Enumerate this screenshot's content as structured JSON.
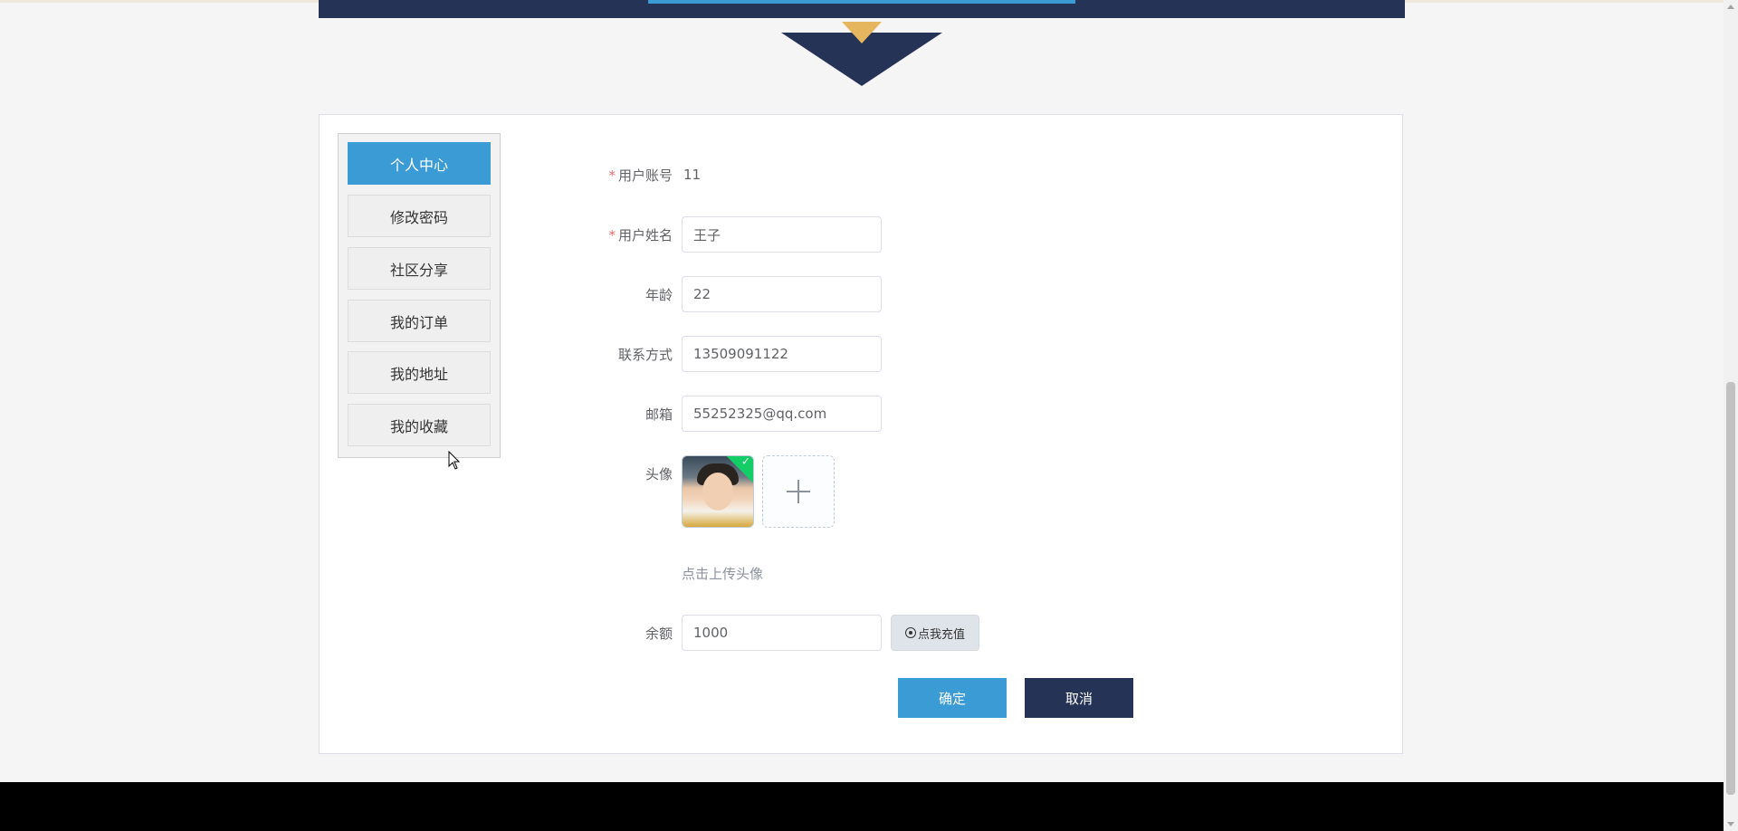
{
  "menu": {
    "items": [
      {
        "label": "个人中心",
        "active": true
      },
      {
        "label": "修改密码",
        "active": false
      },
      {
        "label": "社区分享",
        "active": false
      },
      {
        "label": "我的订单",
        "active": false
      },
      {
        "label": "我的地址",
        "active": false
      },
      {
        "label": "我的收藏",
        "active": false
      }
    ]
  },
  "form": {
    "account": {
      "label": "用户账号",
      "value": "11",
      "required": true
    },
    "name": {
      "label": "用户姓名",
      "value": "王子",
      "required": true
    },
    "age": {
      "label": "年龄",
      "value": "22"
    },
    "phone": {
      "label": "联系方式",
      "value": "13509091122"
    },
    "email": {
      "label": "邮箱",
      "value": "55252325@qq.com"
    },
    "avatar": {
      "label": "头像",
      "upload_hint": "点击上传头像"
    },
    "balance": {
      "label": "余额",
      "value": "1000",
      "recharge_label": "点我充值"
    },
    "required_mark": "*"
  },
  "actions": {
    "confirm": "确定",
    "cancel": "取消"
  },
  "colors": {
    "primary": "#3a9bd5",
    "navy": "#253356",
    "accent": "#e5b65d",
    "success": "#13ce66"
  },
  "icons": {
    "plus": "plus-icon",
    "recharge": "radio-dot-icon",
    "check": "check-icon"
  }
}
